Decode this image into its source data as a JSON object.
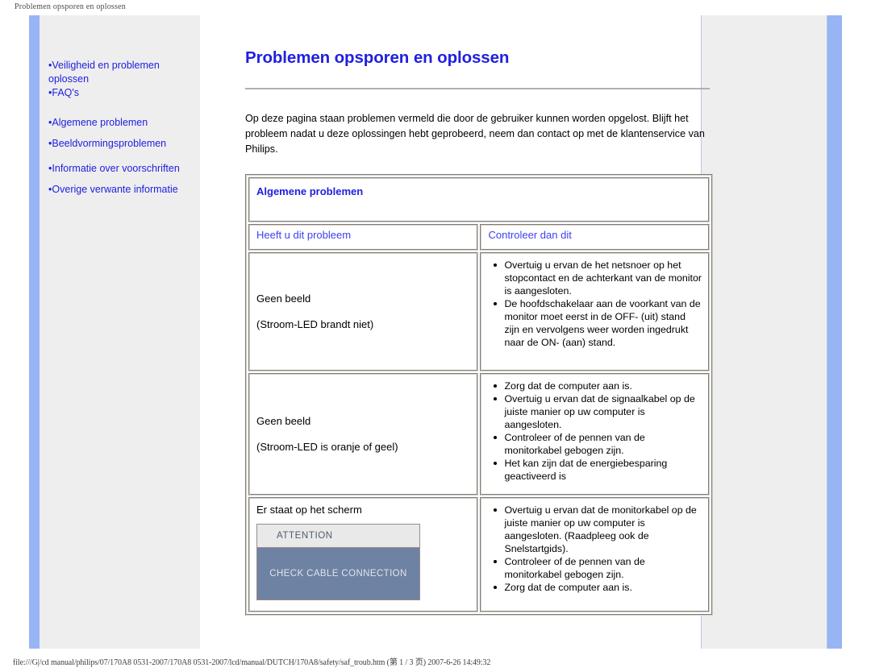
{
  "print_header": "Problemen opsporen en oplossen",
  "colors": {
    "link_blue": "#2020e0",
    "heading_blue": "#2020e0",
    "band_blue": "#97b5f5",
    "sidebar_gray": "#eeeeee",
    "attention_body": "#6e82a3",
    "attention_header": "#e9e9e9"
  },
  "sidebar": {
    "items": [
      {
        "label": "Veiligheid en problemen oplossen"
      },
      {
        "label": "FAQ's"
      },
      {
        "label": "Algemene problemen"
      },
      {
        "label": "Beeldvormingsproblemen"
      },
      {
        "label": "Informatie over voorschriften"
      },
      {
        "label": "Overige verwante informatie"
      }
    ],
    "bullet": "•"
  },
  "main": {
    "title": "Problemen opsporen en oplossen",
    "intro": "Op deze pagina staan problemen vermeld die door de gebruiker kunnen worden opgelost. Blijft het probleem nadat u deze oplossingen hebt geprobeerd, neem dan contact op met de klantenservice van Philips.",
    "table": {
      "section_title": "Algemene problemen",
      "col_headers": {
        "question": "Heeft u dit probleem",
        "answer": "Controleer dan dit"
      },
      "rows": [
        {
          "question_line1": "Geen beeld",
          "question_line2": "(Stroom-LED brandt niet)",
          "answers": [
            "Overtuig u ervan de het netsnoer op het stopcontact en de achterkant van de monitor is aangesloten.",
            "De hoofdschakelaar aan de voorkant van de monitor moet eerst in de OFF- (uit) stand zijn en vervolgens weer worden ingedrukt naar de ON- (aan) stand."
          ]
        },
        {
          "question_line1": "Geen beeld",
          "question_line2": "(Stroom-LED is oranje of geel)",
          "answers": [
            "Zorg dat de computer aan is.",
            "Overtuig u ervan dat de signaalkabel op de juiste manier op uw computer is aangesloten.",
            "Controleer of de pennen van de monitorkabel gebogen zijn.",
            "Het kan zijn dat de energiebesparing geactiveerd is"
          ]
        },
        {
          "question_line1": "Er staat op het scherm",
          "question_line2": "",
          "image": {
            "header_text": "ATTENTION",
            "body_text": "CHECK CABLE CONNECTION"
          },
          "answers": [
            "Overtuig u ervan dat de monitorkabel op de juiste manier op uw computer is aangesloten. (Raadpleeg ook de Snelstartgids).",
            "Controleer of de pennen van de monitorkabel gebogen zijn.",
            "Zorg dat de computer aan is."
          ]
        }
      ]
    }
  },
  "footer": "file:///G|/cd manual/philips/07/170A8 0531-2007/170A8 0531-2007/lcd/manual/DUTCH/170A8/safety/saf_troub.htm (第 1 / 3 页) 2007-6-26 14:49:32"
}
